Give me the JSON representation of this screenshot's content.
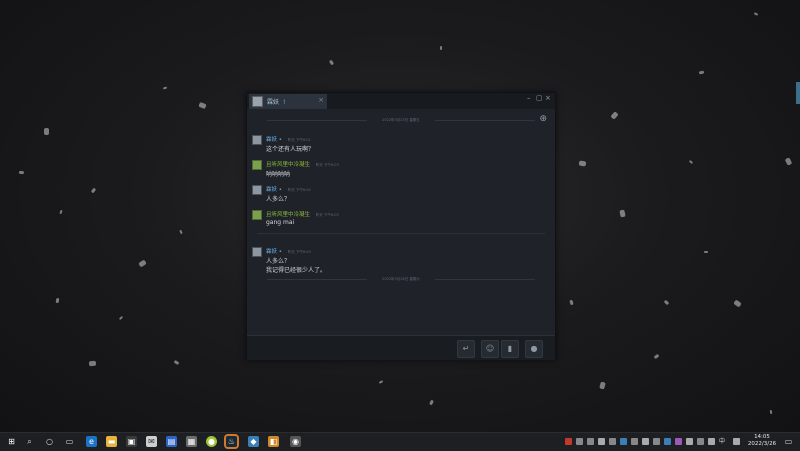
{
  "chat": {
    "tab_name": "霖妖",
    "tab_suffix": "!",
    "date_top": "2022年3月25日 星期五",
    "date_bottom": "2022年3月26日 星期六",
    "messages": [
      {
        "sender": "霖妖",
        "sender_suffix": "•",
        "color": "blue",
        "time": "昨天 下午6:01",
        "lines": [
          "这个还有人玩啊？"
        ]
      },
      {
        "sender": "且听风里中冷凝生",
        "color": "green",
        "time": "昨天 下午6:03",
        "lines": [
          "呐呐呐呐"
        ]
      },
      {
        "sender": "霖妖",
        "sender_suffix": "•",
        "color": "blue",
        "time": "昨天 下午6:04",
        "lines": [
          "人多么？"
        ]
      },
      {
        "sender": "且听风里中冷凝生",
        "color": "green",
        "time": "昨天 下午6:05",
        "lines": [
          "gang mai"
        ]
      },
      {
        "sender": "霖妖",
        "sender_suffix": "•",
        "color": "blue",
        "time": "昨天 下午6:09",
        "lines": [
          "人多么？",
          "我记得已经很少人了。"
        ]
      }
    ]
  },
  "icons": {
    "send": "send-icon",
    "emoji": "emoji-icon",
    "attach": "attach-icon",
    "voice": "voice-icon",
    "add_friend": "add-friend-icon"
  },
  "taskbar": {
    "time": "14:05",
    "date": "2022/3/26",
    "ime": "中"
  }
}
